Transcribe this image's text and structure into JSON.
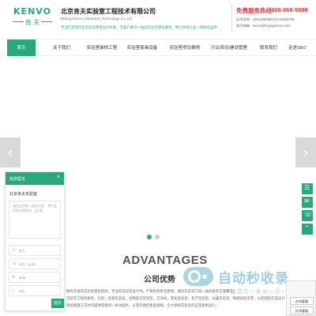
{
  "header": {
    "logo_word": "KENVO",
    "logo_cn": "肯 夫",
    "company_cn": "北京肯夫实验室工程技术有限公司",
    "company_en": "Beijing Kenvo Laboratory Technology Co.,Ltd",
    "slogan": "专注打造现代化实验室建设设计标准，方案户解决一站式实验室建设服务，致力协会行业一线知名品牌",
    "hotline_label": "免费服务热线：",
    "hotline_number": "400-968-5698",
    "contact_lines": [
      "技术咨询：15010985880/13716382756",
      "电子邮箱：kenvo@beijingkenvo.com"
    ]
  },
  "nav": {
    "items": [
      "首页",
      "关于我们",
      "实验室装修工程",
      "实验室家具设备",
      "实验室项目案例",
      "行业资讯/建设管理",
      "联系我们",
      "走进SEO"
    ],
    "active_index": 0
  },
  "banner": {
    "prev_glyph": "‹",
    "next_glyph": "›",
    "dot_count": 2,
    "active_dot": 0
  },
  "advantages": {
    "title_en": "ADVANTAGES",
    "title_cn": "公司优势",
    "lines": [
      "拥有丰富的实验室建设经验，专业的实验室设计师，严格的系统化管理，满足实验室工程一站式服务实施需求。",
      "实验室工程的服务，包括：生物实验室，生物安全实验室，洁净间，理化实验室，化学实验室，仪器实验室，物理试验室等，从前期的方案设计",
      "到后期施工交付均提供完善的一条龙服务，以及完善的售后保障，全力保障实验室的正常使用运行。"
    ]
  },
  "watermark": {
    "text": "自动秒收录",
    "sub": "一键提交一来访一次一自动收录"
  },
  "form": {
    "title": "给您留言",
    "close": "×",
    "sub_title": "北京肯夫实验室",
    "textarea_placeholder": "请在这里输入留言内容，我们会尽快与您联系。(必填)",
    "fields": [
      {
        "icon": "⚇",
        "placeholder": "姓名"
      },
      {
        "icon": "☏",
        "placeholder": "电话（必填）"
      },
      {
        "icon": "✉",
        "placeholder": "邮箱"
      },
      {
        "icon": "⌂",
        "placeholder": "地址"
      }
    ],
    "submit": "提交"
  },
  "side_tabs": [
    {
      "name": "online-service",
      "glyph": "☰"
    },
    {
      "name": "wechat",
      "glyph": "✉"
    },
    {
      "name": "phone",
      "glyph": "☏"
    },
    {
      "name": "back-to-top",
      "glyph": "⌃"
    }
  ],
  "widget": {
    "buttons": [
      "在线客服",
      "技术客服"
    ]
  },
  "colors": {
    "brand": "#2aa87b",
    "hotline": "#e03a3a",
    "arrow_bg": "#d9d9d9"
  }
}
